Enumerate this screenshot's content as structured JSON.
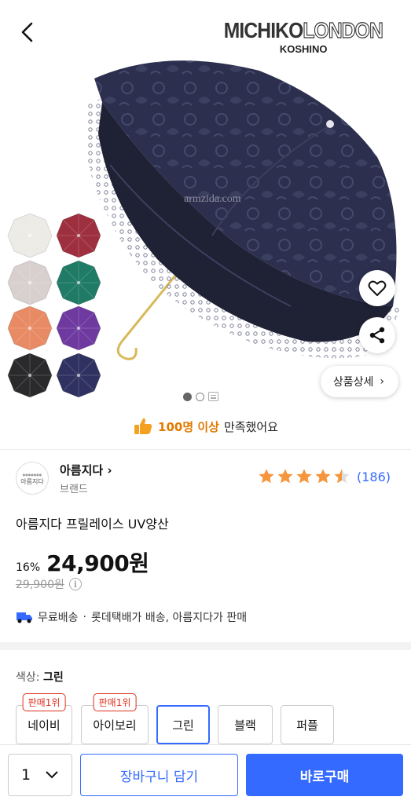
{
  "header": {
    "back_icon": "chevron-left-icon",
    "logo_line1_solid": "MICHIKO",
    "logo_line1_outline": "LONDON",
    "logo_line2": "KOSHINO"
  },
  "hero": {
    "watermark": "armzida.com",
    "swatch_colors": [
      "#ecebe6",
      "#9e2f3e",
      "#d8cfcf",
      "#1f7a66",
      "#e88a64",
      "#6e3aa0",
      "#2a2a2c",
      "#2f3160"
    ],
    "main_umbrella_color": "#2c2f4d",
    "like_icon": "heart-icon",
    "share_icon": "share-icon",
    "detail_label": "상품상세",
    "pager_count": 2,
    "pager_active": 1
  },
  "satisfaction": {
    "highlight": "100명 이상",
    "text": "만족했어요"
  },
  "brand": {
    "avatar_text": "아름지다",
    "name": "아름지다",
    "sub": "브랜드",
    "rating": 4.5,
    "review_count": "(186)"
  },
  "product": {
    "title": "아름지다 프릴레이스 UV양산",
    "discount": "16%",
    "price": "24,900원",
    "original_price": "29,900원",
    "info_icon": "info-icon"
  },
  "shipping": {
    "icon": "truck-icon",
    "free": "무료배송",
    "separator": "·",
    "detail": "롯데택배가 배송, 아름지다가 판매"
  },
  "options": {
    "label": "색상:",
    "selected": "그린",
    "items": [
      {
        "label": "네이비",
        "badge": "판매1위"
      },
      {
        "label": "아이보리",
        "badge": "판매1위"
      },
      {
        "label": "그린",
        "badge": ""
      },
      {
        "label": "블랙",
        "badge": ""
      },
      {
        "label": "퍼플",
        "badge": ""
      }
    ]
  },
  "bottom_bar": {
    "quantity": "1",
    "cart_label": "장바구니 담기",
    "buy_label": "바로구매"
  },
  "colors": {
    "accent": "#346aff",
    "badge_red": "#e0301e",
    "star": "#f5963c",
    "highlight_orange": "#e07a00"
  }
}
